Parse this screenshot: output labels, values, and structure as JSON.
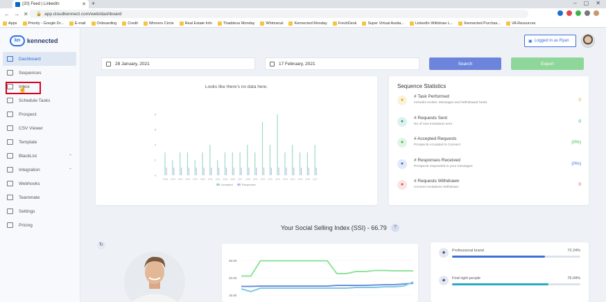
{
  "browser": {
    "tab_title": "(20) Feed | LinkedIn",
    "url": "app.cloudkennect.com/web/dashboard",
    "bookmarks": [
      "Apps",
      "Priority - Google Dr...",
      "E-mail",
      "Onboarding",
      "Credit",
      "Winners Circle",
      "Real Estate Info",
      "Thaddeus Monday",
      "Whimsical",
      "Kennected Monday",
      "FreshDesk",
      "Super Virtual Assita...",
      "LinkedIn Withdraw L...",
      "Kennected Purchas...",
      "VA Resources"
    ]
  },
  "brand": {
    "name": "kennected",
    "mark": "kn"
  },
  "sidebar": {
    "items": [
      {
        "label": "Dashboard",
        "icon": "monitor-icon",
        "active": true
      },
      {
        "label": "Sequences",
        "icon": "list-icon"
      },
      {
        "label": "Inbox",
        "icon": "inbox-icon"
      },
      {
        "label": "Schedule Tasks",
        "icon": "clock-icon"
      },
      {
        "label": "Prospect",
        "icon": "users-icon"
      },
      {
        "label": "CSV Viewer",
        "icon": "file-icon"
      },
      {
        "label": "Template",
        "icon": "template-icon"
      },
      {
        "label": "BlackList",
        "icon": "grid-icon",
        "expandable": true
      },
      {
        "label": "Integration",
        "icon": "plug-icon",
        "expandable": true
      },
      {
        "label": "Webhooks",
        "icon": "webhook-icon"
      },
      {
        "label": "Teammate",
        "icon": "teammate-icon"
      },
      {
        "label": "Settings",
        "icon": "gear-icon"
      },
      {
        "label": "Pricing",
        "icon": "dollar-icon"
      }
    ]
  },
  "header": {
    "logged_in": "Logged in as Ryan"
  },
  "filters": {
    "start_date": "28 January, 2021",
    "end_date": "17 February, 2021",
    "search_label": "Search",
    "export_label": "Export"
  },
  "chart_data": {
    "type": "bar",
    "title": "Looks like there's no data here.",
    "categories": [
      "2/28",
      "2/29",
      "2/30",
      "2/31",
      "2/01",
      "2/02",
      "2/03",
      "2/04",
      "2/05",
      "2/06",
      "2/07",
      "2/08",
      "2/09",
      "2/10",
      "2/11",
      "2/12",
      "2/13",
      "2/14",
      "2/15",
      "2/16",
      "2/17"
    ],
    "series": [
      {
        "name": "Accepted",
        "values": [
          3,
          2,
          3,
          3,
          2,
          3,
          4,
          2,
          3,
          3,
          3,
          4,
          3,
          7,
          4,
          8,
          3,
          4,
          3,
          3,
          4
        ]
      },
      {
        "name": "Responses",
        "values": [
          1,
          1,
          1,
          1,
          1,
          1,
          1,
          1,
          1,
          1,
          1,
          1,
          1,
          1,
          1,
          1,
          1,
          1,
          1,
          1,
          1
        ]
      }
    ],
    "colors": [
      "#9fd8c4",
      "#b8bef0"
    ],
    "yticks": [
      "8",
      "6",
      "4",
      "2",
      "0"
    ]
  },
  "stats": {
    "title": "Sequence Statistics",
    "items": [
      {
        "title": "# Task Performed",
        "subtitle": "Includes Invites, Messages and Withdrawal Tasks",
        "value": "0",
        "color": "#e0a800",
        "icon": "task-icon"
      },
      {
        "title": "# Requests Sent",
        "subtitle": "No of new Invitations sent",
        "value": "0",
        "color": "#20a090",
        "icon": "user-plus-icon"
      },
      {
        "title": "# Accepted Requests",
        "subtitle": "Prospects Accepted to Connect",
        "value": "(0%)",
        "color": "#3bb54a",
        "icon": "check-circle-icon"
      },
      {
        "title": "# Responses Received",
        "subtitle": "Prospects responded to your messages",
        "value": "(0%)",
        "color": "#3a6fd8",
        "icon": "chat-icon"
      },
      {
        "title": "# Requests Withdrawn",
        "subtitle": "Connect Invitations Withdrawn",
        "value": "0",
        "color": "#e04848",
        "icon": "user-minus-icon"
      }
    ]
  },
  "ssi": {
    "title": "Your Social Selling Index (SSI) - 66.79",
    "help": "?",
    "refresh": "↻",
    "chart_data": {
      "type": "line",
      "yticks": [
        "25.00",
        "20.00",
        "15.00"
      ],
      "series": [
        {
          "name": "",
          "values": [
            20.5,
            20.5,
            24.9,
            24.9,
            24.9,
            24.9,
            24.9,
            24.9,
            24.9,
            24.9,
            21.2,
            21.2,
            21.8,
            21.8,
            22.1,
            22.1,
            22.0,
            22.0,
            22.0
          ],
          "color": "#8de39c"
        },
        {
          "name": "",
          "values": [
            17.5,
            17.5,
            17.6,
            17.6,
            17.6,
            17.6,
            17.6,
            17.6,
            17.6,
            17.6,
            17.8,
            17.8,
            17.8,
            17.8,
            17.9,
            18.0,
            18.0,
            18.2,
            18.4
          ],
          "color": "#6b8fd8"
        },
        {
          "name": "",
          "values": [
            16.8,
            16.0,
            17.0,
            17.0,
            17.0,
            17.0,
            17.0,
            17.0,
            17.0,
            17.0,
            17.0,
            17.0,
            17.2,
            17.2,
            17.2,
            17.4,
            17.4,
            17.6,
            18.8
          ],
          "color": "#7fc8e8"
        }
      ]
    },
    "components": [
      {
        "label": "Professional brand",
        "value": "72.24%",
        "fraction": 0.7224,
        "color": "#3a6fd8",
        "icon": "award-icon"
      },
      {
        "label": "Find right people",
        "value": "75.04%",
        "fraction": 0.7504,
        "color": "#2aa8c4",
        "icon": "people-icon"
      }
    ]
  }
}
